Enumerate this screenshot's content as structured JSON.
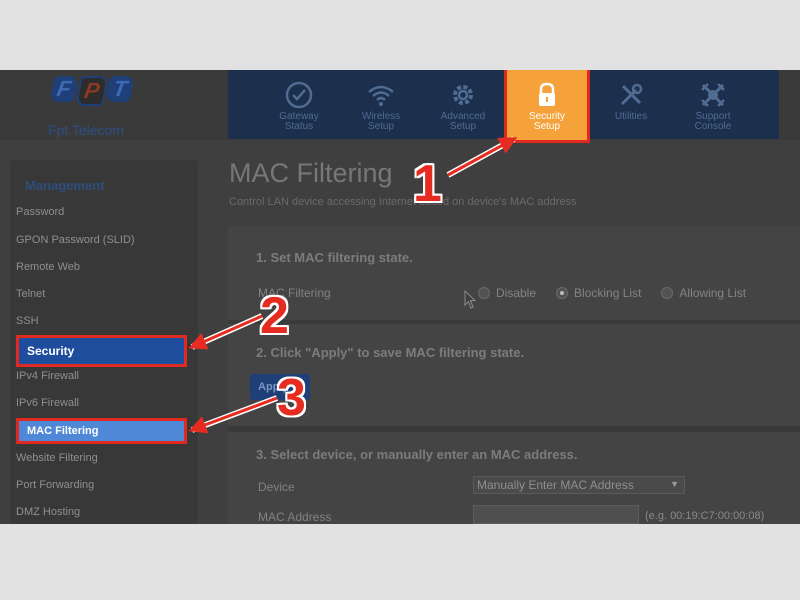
{
  "brand": {
    "logo_letters": [
      "F",
      "P",
      "T"
    ],
    "name": "Fpt Telecom"
  },
  "nav": {
    "items": [
      {
        "label": "Gateway\nStatus",
        "icon": "gauge-icon"
      },
      {
        "label": "Wireless\nSetup",
        "icon": "wifi-icon"
      },
      {
        "label": "Advanced\nSetup",
        "icon": "gear-icon"
      },
      {
        "label": "Security\nSetup",
        "icon": "lock-icon"
      },
      {
        "label": "Utilities",
        "icon": "tools-icon"
      },
      {
        "label": "Support\nConsole",
        "icon": "support-icon"
      }
    ],
    "active": "Security Setup"
  },
  "sidebar": {
    "heading": "Management",
    "items": [
      "Password",
      "GPON Password (SLID)",
      "Remote Web",
      "Telnet",
      "SSH",
      "Security",
      "IPv4 Firewall",
      "IPv6 Firewall",
      "MAC Filtering",
      "Website Filtering",
      "Port Forwarding",
      "DMZ Hosting"
    ]
  },
  "main": {
    "title": "MAC Filtering",
    "subtitle": "Control LAN device accessing Internet based on device's MAC address",
    "section1": {
      "title": "1. Set MAC filtering state.",
      "label": "MAC Filtering",
      "options": [
        "Disable",
        "Blocking List",
        "Allowing List"
      ],
      "selected": "Blocking List"
    },
    "section2": {
      "title": "2. Click \"Apply\" to save MAC filtering state.",
      "apply_label": "Apply"
    },
    "section3": {
      "title": "3. Select device, or manually enter an MAC address.",
      "device_label": "Device",
      "device_value": "Manually Enter MAC Address",
      "mac_label": "MAC Address",
      "mac_value": "",
      "mac_hint": "(e.g. 00:19:C7:00:00:08)"
    }
  },
  "annotations": [
    "1",
    "2",
    "3"
  ],
  "colors": {
    "annotation_red": "#e62b21",
    "active_tab": "#f5a23a",
    "nav_bg": "#1c2f4d",
    "highlight_blue": "#1f4d9e"
  }
}
